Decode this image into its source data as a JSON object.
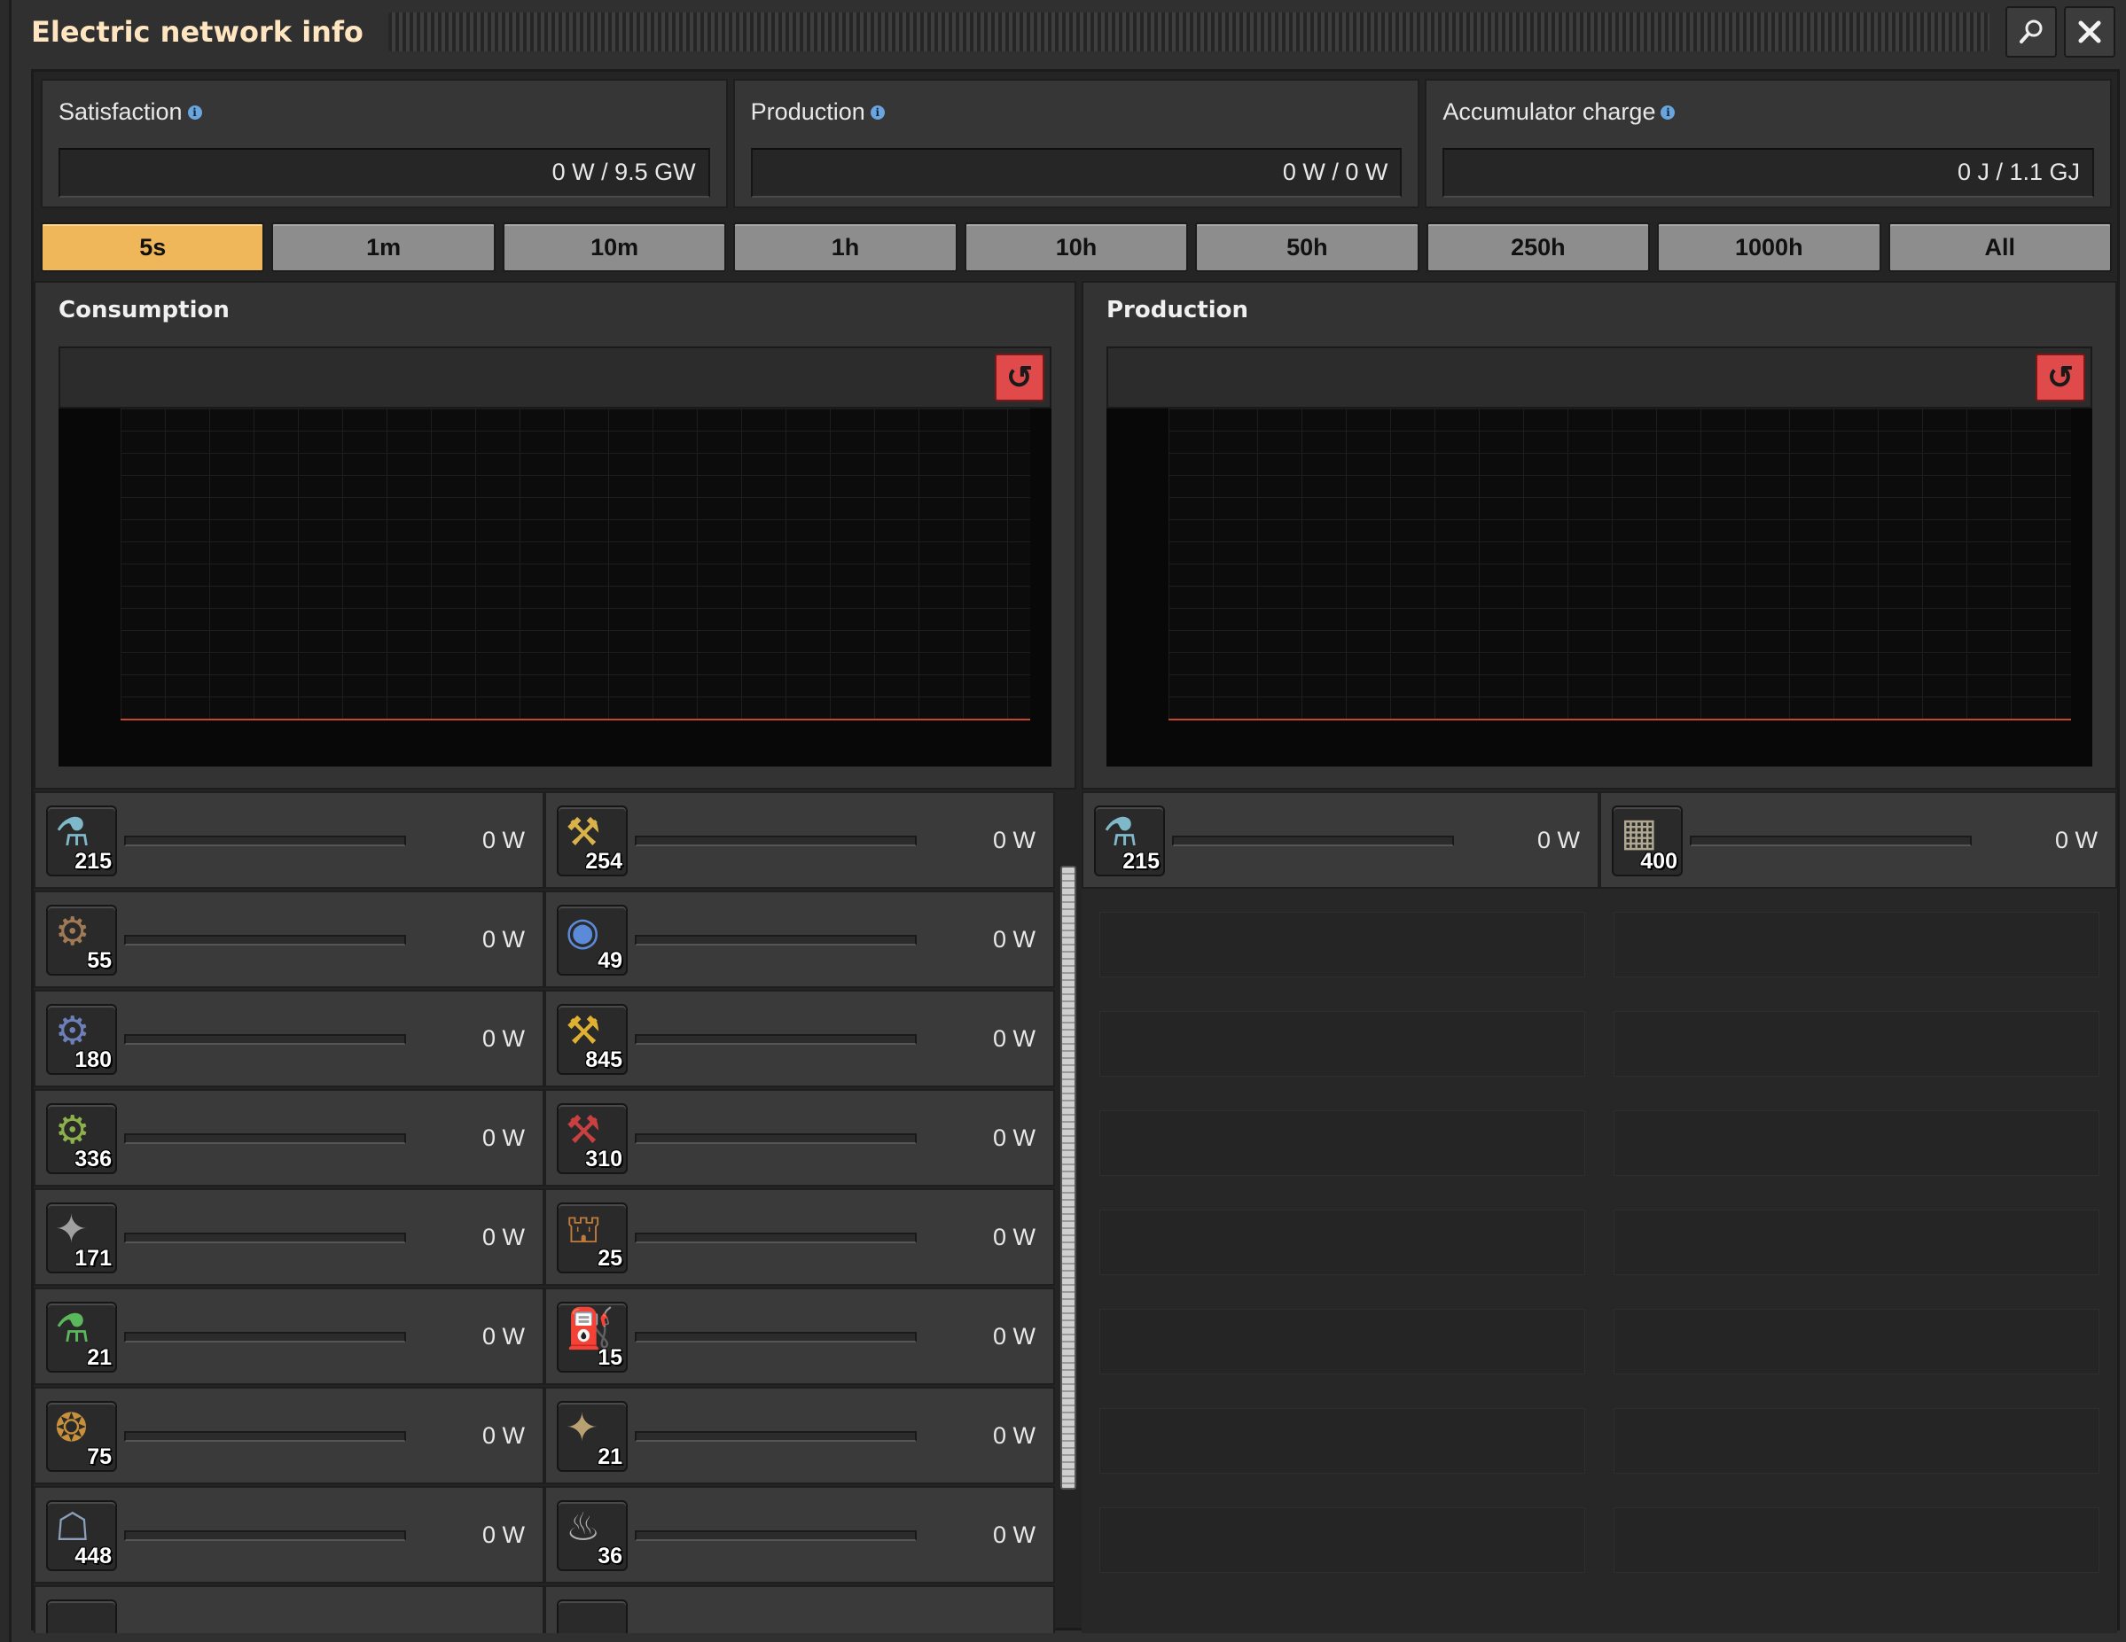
{
  "window": {
    "title": "Electric network info"
  },
  "titlebar": {
    "search_icon": "search-icon",
    "close_icon": "close-icon"
  },
  "stats": {
    "satisfaction": {
      "label": "Satisfaction",
      "value": "0 W / 9.5 GW"
    },
    "production": {
      "label": "Production",
      "value": "0 W / 0 W"
    },
    "accumulator": {
      "label": "Accumulator charge",
      "value": "0 J / 1.1 GJ"
    }
  },
  "tabs": [
    "5s",
    "1m",
    "10m",
    "1h",
    "10h",
    "50h",
    "250h",
    "1000h",
    "All"
  ],
  "active_tab": "5s",
  "graphs": {
    "consumption": {
      "title": "Consumption"
    },
    "production": {
      "title": "Production"
    }
  },
  "consumers": [
    {
      "icon": "lab-icon",
      "count": "215",
      "power": "0 W",
      "color": "#7fb8c8"
    },
    {
      "icon": "fast-inserter-icon",
      "count": "254",
      "power": "0 W",
      "color": "#d9b24a"
    },
    {
      "icon": "assembling-machine-1-icon",
      "count": "55",
      "power": "0 W",
      "color": "#a07a55"
    },
    {
      "icon": "radar-icon",
      "count": "49",
      "power": "0 W",
      "color": "#5a8ad8"
    },
    {
      "icon": "assembling-machine-2-icon",
      "count": "180",
      "power": "0 W",
      "color": "#6c7fb8"
    },
    {
      "icon": "stack-inserter-icon",
      "count": "845",
      "power": "0 W",
      "color": "#e0b030"
    },
    {
      "icon": "assembling-machine-3-icon",
      "count": "336",
      "power": "0 W",
      "color": "#8cb04a"
    },
    {
      "icon": "long-handed-inserter-icon",
      "count": "310",
      "power": "0 W",
      "color": "#c84040"
    },
    {
      "icon": "electric-mining-drill-icon",
      "count": "171",
      "power": "0 W",
      "color": "#a0a0a0"
    },
    {
      "icon": "oil-refinery-icon",
      "count": "25",
      "power": "0 W",
      "color": "#c07a3a"
    },
    {
      "icon": "chemical-plant-icon",
      "count": "21",
      "power": "0 W",
      "color": "#5ab85a"
    },
    {
      "icon": "pumpjack-icon",
      "count": "15",
      "power": "0 W",
      "color": "#7ab05a"
    },
    {
      "icon": "centrifuge-icon",
      "count": "75",
      "power": "0 W",
      "color": "#c8903a"
    },
    {
      "icon": "beacon-icon",
      "count": "21",
      "power": "0 W",
      "color": "#b8a070"
    },
    {
      "icon": "roboport-icon",
      "count": "448",
      "power": "0 W",
      "color": "#8aa0b8"
    },
    {
      "icon": "electric-furnace-icon",
      "count": "36",
      "power": "0 W",
      "color": "#b0b0b0"
    }
  ],
  "producers": [
    {
      "icon": "lab-icon",
      "count": "215",
      "power": "0 W",
      "color": "#7fb8c8"
    },
    {
      "icon": "accumulator-icon",
      "count": "400",
      "power": "0 W",
      "color": "#b0a890"
    }
  ]
}
